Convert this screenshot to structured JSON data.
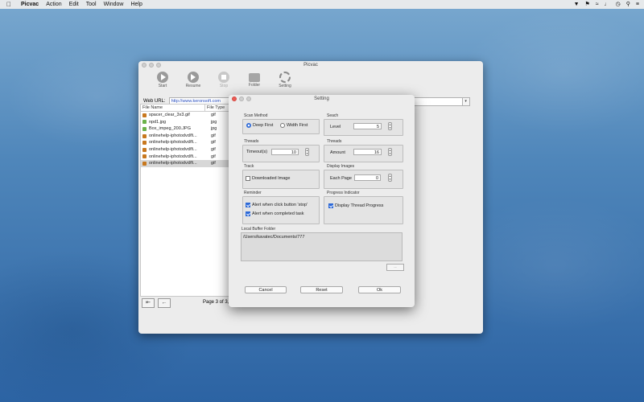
{
  "menubar": {
    "app_name": "Picvac",
    "items": [
      "Action",
      "Edit",
      "Tool",
      "Window",
      "Help"
    ]
  },
  "main_window": {
    "title": "Picvac",
    "toolbar": {
      "start": "Start",
      "resume": "Resume",
      "stop": "Stop",
      "folder": "Folder",
      "setting": "Setting"
    },
    "url_label": "Web URL:",
    "url_value": "http://www.keronsoft.com",
    "columns": {
      "name": "File Name",
      "type": "File Type"
    },
    "files": [
      {
        "name": "spacer_clear_3x3.gif",
        "type": "gif",
        "icon": "gif-file-icon"
      },
      {
        "name": "npd1.jpg",
        "type": "jpg",
        "icon": "jpg-file-icon"
      },
      {
        "name": "Box_impeg_200.JPG",
        "type": "jpg",
        "icon": "jpg-file-icon"
      },
      {
        "name": "onlinehelp-iphotodvd/fi...",
        "type": "gif",
        "icon": "gif-file-icon"
      },
      {
        "name": "onlinehelp-iphotodvd/fi...",
        "type": "gif",
        "icon": "gif-file-icon"
      },
      {
        "name": "onlinehelp-iphotodvd/fi...",
        "type": "gif",
        "icon": "gif-file-icon"
      },
      {
        "name": "onlinehelp-iphotodvd/fi...",
        "type": "gif",
        "icon": "gif-file-icon"
      },
      {
        "name": "onlinehelp-iphotodvd/fi...",
        "type": "gif",
        "icon": "gif-file-icon"
      }
    ],
    "page_info": "Page 3 of 3,"
  },
  "settings": {
    "title": "Setting",
    "scan_method": {
      "title": "Scan Method",
      "deep": "Deep First",
      "width": "Width First",
      "selected": "deep"
    },
    "seach": {
      "title": "Seach",
      "level_label": "Level",
      "level_value": "5"
    },
    "threads_left": {
      "title": "Threads",
      "label": "Timeout(s)",
      "value": "10"
    },
    "threads_right": {
      "title": "Threads",
      "label": "Amount",
      "value": "16"
    },
    "track": {
      "title": "Track",
      "downloaded": "Downloaded Image",
      "checked": false
    },
    "display_images": {
      "title": "Display Images",
      "label": "Each Page",
      "value": "0"
    },
    "reminder": {
      "title": "Reminder",
      "stop_alert": "Alert when click button 'stop'",
      "complete_alert": "Alert when completed task"
    },
    "progress": {
      "title": "Progress Indicator",
      "display_thread": "Display Thread Progress"
    },
    "buffer": {
      "title": "Local Buffer Folder",
      "path": "/Users/kavatec/Documents/777",
      "browse": "..."
    },
    "buttons": {
      "cancel": "Cancel",
      "reset": "Reset",
      "ok": "Ok"
    }
  }
}
